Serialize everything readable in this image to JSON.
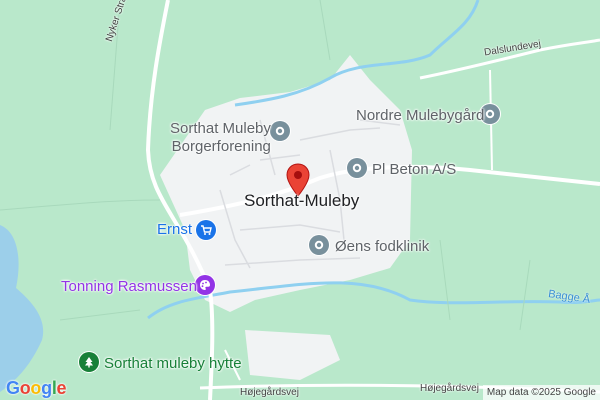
{
  "map": {
    "center_label": "Sorthat-Muleby",
    "roads": {
      "nyker_strandvej": "Nyker Strandvej",
      "dalslundevej": "Dalslundevej",
      "hojegardsvej_left": "Højegårdsvej",
      "hojegardsvej_right": "Højegårdsvej"
    },
    "water": {
      "bagge_a": "Bagge Å"
    },
    "places": [
      {
        "label": "Sorthat Muleby\nBorgerforening",
        "icon": "place-pin-icon",
        "category": "landmark"
      },
      {
        "label": "Nordre Mulebygård",
        "icon": "place-pin-icon",
        "category": "landmark"
      },
      {
        "label": "Pl Beton A/S",
        "icon": "place-pin-icon",
        "category": "business"
      },
      {
        "label": "Ernst",
        "icon": "shopping-cart-icon",
        "category": "shop"
      },
      {
        "label": "Øens fodklinik",
        "icon": "place-pin-icon",
        "category": "clinic"
      },
      {
        "label": "Tonning Rasmussen",
        "icon": "paint-palette-icon",
        "category": "art"
      },
      {
        "label": "Sorthat muleby hytte",
        "icon": "tree-icon",
        "category": "park"
      }
    ],
    "colors": {
      "land": "#b6e7c9",
      "settlement": "#f1f3f4",
      "water": "#9ccfea",
      "road": "#ffffff",
      "red_pin": "#ea4335"
    }
  },
  "footer": {
    "logo": [
      "G",
      "o",
      "o",
      "g",
      "l",
      "e"
    ],
    "attribution": "Map data ©2025 Google"
  }
}
